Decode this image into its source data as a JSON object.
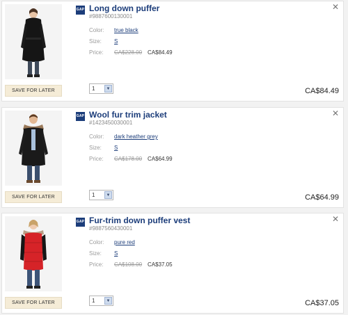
{
  "items": [
    {
      "title": "Long down puffer",
      "sku": "#9887600130001",
      "color_label": "Color:",
      "color": "true black",
      "size_label": "Size:",
      "size": "S",
      "price_label": "Price:",
      "price_old": "CA$228.00",
      "price_new": "CA$84.49",
      "qty": "1",
      "total": "CA$84.49",
      "save_label": "SAVE FOR LATER",
      "logo": "GAP",
      "close": "✕"
    },
    {
      "title": "Wool fur trim jacket",
      "sku": "#1423450030001",
      "color_label": "Color:",
      "color": "dark heather grey",
      "size_label": "Size:",
      "size": "S",
      "price_label": "Price:",
      "price_old": "CA$178.00",
      "price_new": "CA$64.99",
      "qty": "1",
      "total": "CA$64.99",
      "save_label": "SAVE FOR LATER",
      "logo": "GAP",
      "close": "✕"
    },
    {
      "title": "Fur-trim down puffer vest",
      "sku": "#9887560430001",
      "color_label": "Color:",
      "color": "pure red",
      "size_label": "Size:",
      "size": "S",
      "price_label": "Price:",
      "price_old": "CA$108.00",
      "price_new": "CA$37.05",
      "qty": "1",
      "total": "CA$37.05",
      "save_label": "SAVE FOR LATER",
      "logo": "GAP",
      "close": "✕"
    }
  ],
  "colors": {
    "brand": "#1c3d7a",
    "save_button_bg": "#f5ecd7",
    "card_bg": "#ffffff"
  },
  "icons": {
    "close": "close-icon",
    "dropdown": "chevron-down-icon",
    "logo": "gap-logo"
  }
}
